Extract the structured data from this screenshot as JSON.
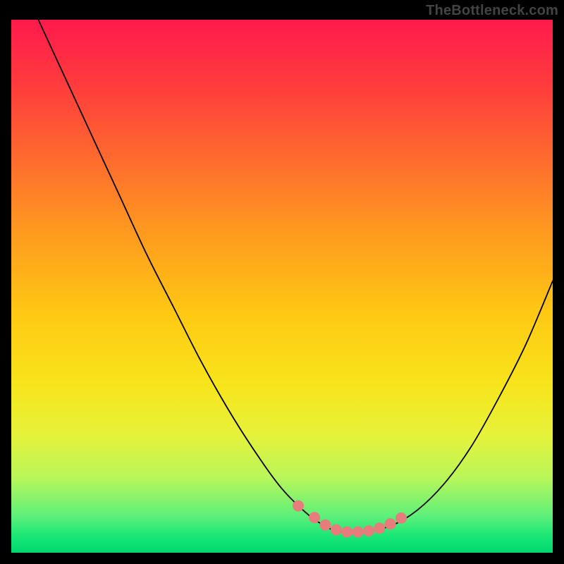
{
  "watermark": "TheBottleneck.com",
  "chart_data": {
    "type": "line",
    "title": "",
    "xlabel": "",
    "ylabel": "",
    "xlim": [
      0,
      100
    ],
    "ylim": [
      0,
      100
    ],
    "grid": false,
    "legend": false,
    "series": [
      {
        "name": "black-curve",
        "color": "#000000",
        "width": 1.8,
        "x": [
          5,
          10,
          15,
          20,
          25,
          30,
          35,
          40,
          45,
          50,
          55,
          58,
          60,
          62,
          65,
          70,
          75,
          80,
          85,
          90,
          95,
          100
        ],
        "values": [
          100,
          89,
          78,
          67,
          56,
          46,
          36,
          27,
          19,
          12,
          7,
          5,
          4,
          4,
          4,
          5,
          8,
          13,
          20,
          29,
          39,
          51
        ]
      },
      {
        "name": "highlight-dots",
        "color": "#e77c7c",
        "marker_radius": 8,
        "x": [
          53,
          56,
          58,
          60,
          62,
          64,
          66,
          68,
          70,
          72
        ],
        "values": [
          8.8,
          6.6,
          5.2,
          4.3,
          3.9,
          3.9,
          4.1,
          4.6,
          5.4,
          6.5
        ]
      }
    ],
    "gradient_stops": [
      {
        "pos": 0,
        "color": "#ff1a4d"
      },
      {
        "pos": 12,
        "color": "#ff3b3d"
      },
      {
        "pos": 26,
        "color": "#ff6a2e"
      },
      {
        "pos": 40,
        "color": "#ff9a1f"
      },
      {
        "pos": 55,
        "color": "#ffc813"
      },
      {
        "pos": 68,
        "color": "#f8e41a"
      },
      {
        "pos": 78,
        "color": "#e6f23a"
      },
      {
        "pos": 86,
        "color": "#b8f65a"
      },
      {
        "pos": 93,
        "color": "#5ff07a"
      },
      {
        "pos": 97,
        "color": "#18e676"
      },
      {
        "pos": 100,
        "color": "#00d86e"
      }
    ]
  }
}
